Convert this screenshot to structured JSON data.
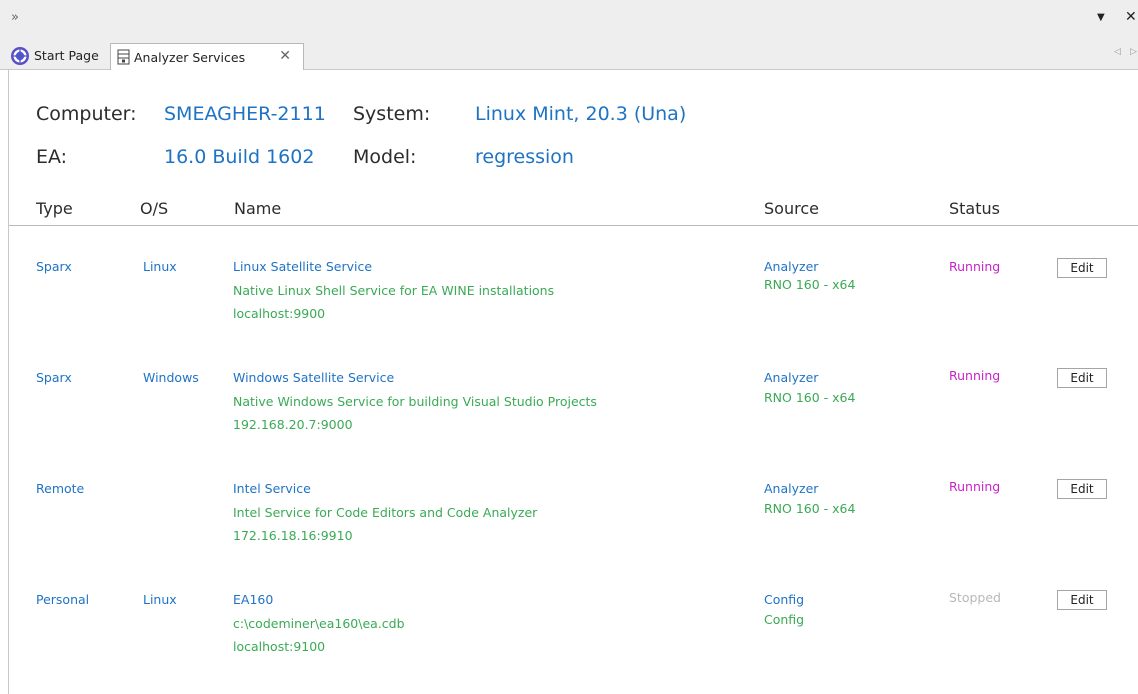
{
  "window": {
    "expand_glyph": "»",
    "dropdown_glyph": "▼",
    "close_glyph": "✕"
  },
  "tabs": [
    {
      "label": "Start Page",
      "icon": "start-page-icon",
      "active": false
    },
    {
      "label": "Analyzer Services",
      "icon": "analyzer-services-icon",
      "active": true,
      "close_glyph": "✕"
    }
  ],
  "tab_scroll": {
    "left": "◁",
    "right": "▷"
  },
  "info": {
    "computer_label": "Computer:",
    "computer_value": "SMEAGHER-2111",
    "system_label": "System:",
    "system_value": "Linux Mint, 20.3 (Una)",
    "ea_label": "EA:",
    "ea_value": "16.0 Build 1602",
    "model_label": "Model:",
    "model_value": "regression"
  },
  "columns": {
    "type": "Type",
    "os": "O/S",
    "name": "Name",
    "source": "Source",
    "status": "Status"
  },
  "services": [
    {
      "type": "Sparx",
      "os": "Linux",
      "name": "Linux Satellite Service",
      "description": "Native Linux Shell Service for EA WINE installations",
      "address": "localhost:9900",
      "source": "Analyzer",
      "source_detail": "RNO 160 - x64",
      "status": "Running",
      "edit": "Edit"
    },
    {
      "type": "Sparx",
      "os": "Windows",
      "name": "Windows Satellite Service",
      "description": "Native Windows Service for building Visual Studio Projects",
      "address": "192.168.20.7:9000",
      "source": "Analyzer",
      "source_detail": "RNO 160 - x64",
      "status": "Running",
      "edit": "Edit"
    },
    {
      "type": "Remote",
      "os": "",
      "name": "Intel Service",
      "description": "Intel Service for Code Editors and Code Analyzer",
      "address": "172.16.18.16:9910",
      "source": "Analyzer",
      "source_detail": "RNO 160 - x64",
      "status": "Running",
      "edit": "Edit"
    },
    {
      "type": "Personal",
      "os": "Linux",
      "name": "EA160",
      "description": "c:\\codeminer\\ea160\\ea.cdb",
      "address": "localhost:9100",
      "source": "Config",
      "source_detail": "Config",
      "status": "Stopped",
      "edit": "Edit"
    }
  ],
  "colors": {
    "link_blue": "#1f73c4",
    "detail_green": "#3aaa55",
    "running_magenta": "#c822c8",
    "stopped_gray": "#b8b8b8"
  }
}
